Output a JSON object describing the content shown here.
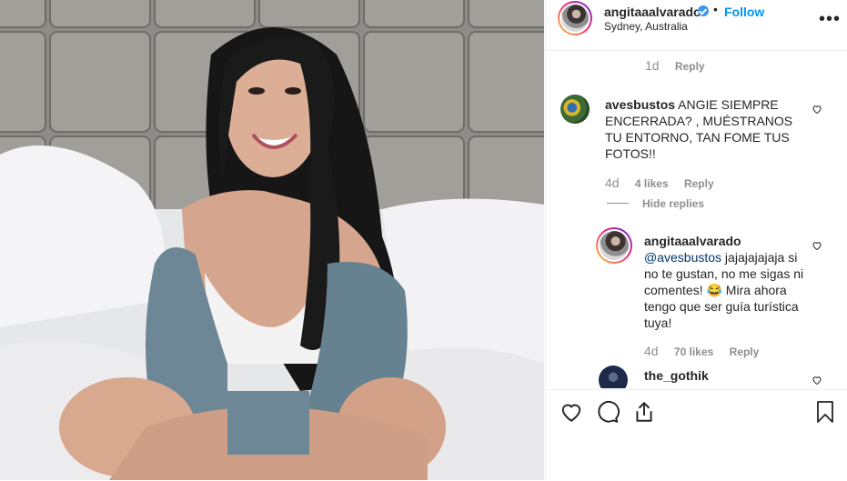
{
  "post": {
    "username": "angitaaalvarado",
    "verified_icon": "verified-badge-icon",
    "separator": "•",
    "follow_label": "Follow",
    "location": "Sydney, Australia",
    "more_icon": "more-options-icon",
    "more_label": "•••"
  },
  "comments": {
    "top": {
      "time": "1d",
      "reply_label": "Reply"
    },
    "avesbustos": {
      "username": "avesbustos",
      "text": "ANGIE SIEMPRE ENCERRADA? , MUÉSTRANOS TU ENTORNO, TAN FOME TUS FOTOS!!",
      "time": "4d",
      "likes": "4 likes",
      "reply_label": "Reply",
      "hide_replies": "Hide replies"
    },
    "reply": {
      "username": "angitaaalvarado",
      "mention": "@avesbustos",
      "text": " jajajajajaja si no te gustan, no me sigas ni comentes! 😂 Mira ahora tengo que ser guía turística tuya!",
      "time": "4d",
      "likes": "70 likes",
      "reply_label": "Reply"
    },
    "gothik": {
      "username": "the_gothik"
    }
  },
  "actions": {
    "like_icon": "heart-icon",
    "comment_icon": "comment-icon",
    "share_icon": "share-icon",
    "save_icon": "bookmark-icon"
  },
  "colors": {
    "accent": "#0095f6",
    "muted": "#8e8e8e",
    "text": "#262626",
    "verified": "#3897f0",
    "mention": "#00376b"
  }
}
